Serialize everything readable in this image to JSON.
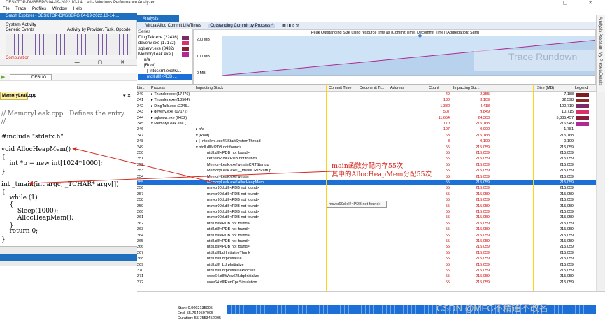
{
  "titlebar": {
    "title": "DESKTOP-DM6BBPG.04-19-2022.10-14-...etl - Windows Performance Analyzer",
    "controls": "— ▢ ✕"
  },
  "menu": [
    "File",
    "Trace",
    "Profiles",
    "Window",
    "Help"
  ],
  "graph_explorer": {
    "title": "Graph Explorer - DESKTOP-DM6BBPG.04-19-2022.10-14-...",
    "section": "System Activity",
    "left_label": "Generic Events",
    "right_label": "Activity by Provider, Task, Opcode",
    "section2": "Computation"
  },
  "vs": {
    "config": "DEBUG",
    "file_tab": "MemoryLeak.cpp"
  },
  "code_lines": [
    "// MemoryLeak.cpp : Defines the entry",
    "//",
    "",
    "#include \"stdafx.h\"",
    "",
    "void AllocHeapMem()",
    "{",
    "    int *p = new int[1024*1000];",
    "}",
    "",
    "int _tmain(int argc, _TCHAR* argv[])",
    "{",
    "    while (1)",
    "    {",
    "        Sleep(1000);",
    "        AllocHeapMem();",
    "    }",
    "    return 0;",
    "}"
  ],
  "analysis": {
    "tab": "Analysis",
    "graph_title": "VirtualAlloc Commit LifeTimes",
    "preset": "Outstanding Commit by Process *",
    "chart_title": "Peak Outstanding Size using resource time as [Commit Time, Decommit Time] (Aggregation: Sum)",
    "series_label": "Series",
    "overlay": "Trace Rundown"
  },
  "series_rows": [
    {
      "name": "DingTalk.exe (22436)",
      "color": "#7a2c6a"
    },
    {
      "name": "devenv.exe (17172)",
      "color": "#d9326a"
    },
    {
      "name": "sqlservr.exe (8432)",
      "color": "#8a1e3a"
    },
    {
      "name": "MemoryLeak.exe (...",
      "color": "#b02a8f"
    },
    {
      "name": "n/a",
      "color": ""
    },
    {
      "name": "[Root]",
      "color": ""
    },
    {
      "name": "|- ntoskrnl.exe!Ki...",
      "color": ""
    },
    {
      "name": "ntdll.dll!<PDB ...",
      "color": "#1b6fd6"
    }
  ],
  "chart_data": {
    "type": "line",
    "title": "Peak Outstanding Size using resource time as [Commit Time, Decommit Time] (Aggregation: Sum)",
    "y_ticks": [
      "200 MB",
      "100 MB",
      "0 MB"
    ],
    "ylim": [
      0,
      230
    ],
    "series": [
      {
        "name": "MemoryLeak.exe",
        "color": "#b02a8f",
        "values": [
          0,
          215
        ]
      }
    ]
  },
  "right_tabs": [
    "Analysis Assistant",
    "My Presets",
    "Details"
  ],
  "columns": [
    "Lin...",
    "Process",
    "Impacting Stack",
    "Commit Time",
    "Decommit Ti...",
    "Address",
    "Count",
    "Impacting Siz...",
    "Size (MB)",
    "Legend"
  ],
  "rows": [
    {
      "line": "240",
      "proc": "▸ Thunder.exe (17476)",
      "stack": "",
      "count": "40",
      "imp": "2,355",
      "size": "7,188",
      "color": "#7a1e1e",
      "sel": false
    },
    {
      "line": "241",
      "proc": "▸ Thunder.exe (18504)",
      "stack": "",
      "count": "130",
      "imp": "3,109",
      "size": "32,598",
      "color": "#8a2b2b",
      "sel": false
    },
    {
      "line": "242",
      "proc": "▸ DingTalk.exe (2245...",
      "stack": "",
      "count": "1,382",
      "imp": "4,418",
      "size": "100,719",
      "color": "#7a2c6a",
      "sel": false
    },
    {
      "line": "243",
      "proc": "▸ devenv.exe (17172)",
      "stack": "",
      "count": "507",
      "imp": "9,849",
      "size": "10,715",
      "color": "#d9326a",
      "sel": false
    },
    {
      "line": "244",
      "proc": "▸ sqlservr.exe (8432)",
      "stack": "",
      "count": "11,654",
      "imp": "24,363",
      "size": "5,835,457",
      "color": "#8a1e3a",
      "sel": false
    },
    {
      "line": "245",
      "proc": "▾ MemoryLeak.exe (...",
      "stack": "",
      "count": "170",
      "imp": "215,168",
      "size": "216,949",
      "color": "#b02a8f",
      "sel": false
    },
    {
      "line": "246",
      "proc": "",
      "stack": "▸ n/a",
      "count": "107",
      "imp": "0,000",
      "size": "1,781",
      "color": "",
      "sel": false
    },
    {
      "line": "247",
      "proc": "",
      "stack": "▾ [Root]",
      "count": "63",
      "imp": "215,168",
      "size": "215,168",
      "color": "",
      "sel": false
    },
    {
      "line": "248",
      "proc": "",
      "stack": "▸ |- ntoskrnl.exe!KiStartSystemThread",
      "count": "8",
      "imp": "0,109",
      "size": "0,109",
      "color": "",
      "sel": false
    },
    {
      "line": "249",
      "proc": "",
      "stack": "▾ ntdll.dll!<PDB not found>",
      "count": "55",
      "imp": "215,059",
      "size": "215,059",
      "color": "",
      "sel": false
    },
    {
      "line": "250",
      "proc": "",
      "stack": "ntdll.dll!<PDB not found>",
      "count": "55",
      "imp": "215,059",
      "size": "215,059",
      "color": "",
      "sel": false
    },
    {
      "line": "251",
      "proc": "",
      "stack": "kernel32.dll!<PDB not found>",
      "count": "55",
      "imp": "215,059",
      "size": "215,059",
      "color": "",
      "sel": false
    },
    {
      "line": "252",
      "proc": "",
      "stack": "MemoryLeak.exe!wmainCRTStartup",
      "count": "55",
      "imp": "215,059",
      "size": "215,059",
      "color": "",
      "sel": false
    },
    {
      "line": "253",
      "proc": "",
      "stack": "MemoryLeak.exe!__tmainCRTStartup",
      "count": "55",
      "imp": "215,059",
      "size": "215,059",
      "color": "",
      "sel": false
    },
    {
      "line": "254",
      "proc": "",
      "stack": "MemoryLeak.exe!wmain",
      "count": "55",
      "imp": "215,059",
      "size": "215,059",
      "color": "",
      "sel": false
    },
    {
      "line": "255",
      "proc": "",
      "stack": "MemoryLeak.exe!AllocHeapMem",
      "count": "55",
      "imp": "215,059",
      "size": "215,059",
      "color": "",
      "sel": true
    },
    {
      "line": "256",
      "proc": "",
      "stack": "msvcr90d.dll!<PDB not found>",
      "count": "55",
      "imp": "215,059",
      "size": "215,059",
      "color": "",
      "sel": false
    },
    {
      "line": "257",
      "proc": "",
      "stack": "msvcr90d.dll!<PDB not found>",
      "count": "55",
      "imp": "215,059",
      "size": "215,059",
      "color": "",
      "sel": false
    },
    {
      "line": "258",
      "proc": "",
      "stack": "msvcr90d.dll!<PDB not found>",
      "count": "55",
      "imp": "215,059",
      "size": "215,059",
      "color": "",
      "sel": false
    },
    {
      "line": "259",
      "proc": "",
      "stack": "msvcr90d.dll!<PDB not found>",
      "count": "55",
      "imp": "215,059",
      "size": "215,059",
      "color": "",
      "sel": false
    },
    {
      "line": "260",
      "proc": "",
      "stack": "msvcr90d.dll!<PDB not found>",
      "count": "55",
      "imp": "215,059",
      "size": "215,059",
      "color": "",
      "sel": false
    },
    {
      "line": "261",
      "proc": "",
      "stack": "msvcr90d.dll!<PDB not found>",
      "count": "55",
      "imp": "215,059",
      "size": "215,059",
      "color": "",
      "sel": false
    },
    {
      "line": "262",
      "proc": "",
      "stack": "ntdll.dll!<PDB not found>",
      "count": "55",
      "imp": "215,059",
      "size": "215,059",
      "color": "",
      "sel": false
    },
    {
      "line": "263",
      "proc": "",
      "stack": "ntdll.dll!<PDB not found>",
      "count": "55",
      "imp": "215,059",
      "size": "215,059",
      "color": "",
      "sel": false
    },
    {
      "line": "264",
      "proc": "",
      "stack": "ntdll.dll!<PDB not found>",
      "count": "55",
      "imp": "215,059",
      "size": "215,059",
      "color": "",
      "sel": false
    },
    {
      "line": "265",
      "proc": "",
      "stack": "ntdll.dll!<PDB not found>",
      "count": "55",
      "imp": "215,059",
      "size": "215,059",
      "color": "",
      "sel": false
    },
    {
      "line": "266",
      "proc": "",
      "stack": "ntdll.dll!<PDB not found>",
      "count": "55",
      "imp": "215,059",
      "size": "215,059",
      "color": "",
      "sel": false
    },
    {
      "line": "267",
      "proc": "",
      "stack": "ntdll.dll!LdrInitializeThunk",
      "count": "55",
      "imp": "215,059",
      "size": "215,059",
      "color": "",
      "sel": false
    },
    {
      "line": "268",
      "proc": "",
      "stack": "ntdll.dll!LdrpInitialize",
      "count": "55",
      "imp": "215,059",
      "size": "215,059",
      "color": "",
      "sel": false
    },
    {
      "line": "269",
      "proc": "",
      "stack": "ntdll.dll!_LdrpInitialize",
      "count": "55",
      "imp": "215,059",
      "size": "215,059",
      "color": "",
      "sel": false
    },
    {
      "line": "270",
      "proc": "",
      "stack": "ntdll.dll!LdrpInitializeProcess",
      "count": "55",
      "imp": "215,059",
      "size": "215,059",
      "color": "",
      "sel": false
    },
    {
      "line": "271",
      "proc": "",
      "stack": "wow64.dll!Wow64LdrpInitialize",
      "count": "55",
      "imp": "215,059",
      "size": "215,059",
      "color": "",
      "sel": false
    },
    {
      "line": "272",
      "proc": "",
      "stack": "wow64.dll!RunCpuSimulation",
      "count": "55",
      "imp": "215,059",
      "size": "215,059",
      "color": "",
      "sel": false
    }
  ],
  "tooltip": "msvcr90d.dll!<PDB not found>",
  "annotation": {
    "line1": "main函数分配内存55次",
    "line2": "其中的AllocHeapMem分配55次",
    "color": "#d4281c"
  },
  "footer": {
    "start": "Start:  0.0092135005",
    "end": "End:  55.7649507005",
    "duration": "Duration:  55.7553452005"
  },
  "watermark": "CSDN @MFC不精通不改名"
}
